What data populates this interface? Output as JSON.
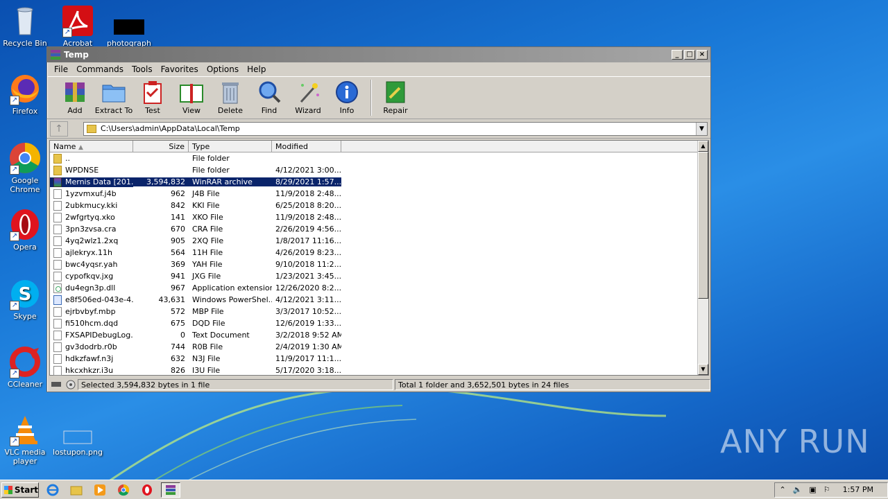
{
  "desktop": {
    "icons": [
      {
        "label": "Recycle Bin"
      },
      {
        "label": "Acrobat"
      },
      {
        "label": "photograph"
      },
      {
        "label": "Firefox"
      },
      {
        "label": "Google Chrome"
      },
      {
        "label": "Opera"
      },
      {
        "label": "Skype"
      },
      {
        "label": "CCleaner"
      },
      {
        "label": "VLC media player"
      },
      {
        "label": "lostupon.png"
      }
    ],
    "watermark": "ANY RUN"
  },
  "window": {
    "title": "Temp",
    "menu": [
      "File",
      "Commands",
      "Tools",
      "Favorites",
      "Options",
      "Help"
    ],
    "toolbar": [
      "Add",
      "Extract To",
      "Test",
      "View",
      "Delete",
      "Find",
      "Wizard",
      "Info",
      "Repair"
    ],
    "address": "C:\\Users\\admin\\AppData\\Local\\Temp",
    "columns": {
      "name": "Name",
      "size": "Size",
      "type": "Type",
      "modified": "Modified"
    },
    "files": [
      {
        "name": "..",
        "size": "",
        "type": "File folder",
        "modified": "",
        "kind": "folder"
      },
      {
        "name": "WPDNSE",
        "size": "",
        "type": "File folder",
        "modified": "4/12/2021 3:00...",
        "kind": "folder"
      },
      {
        "name": "Mernis Data [201...",
        "size": "3,594,832",
        "type": "WinRAR archive",
        "modified": "8/29/2021 1:57...",
        "kind": "rar",
        "selected": true
      },
      {
        "name": "1yzvmxuf.j4b",
        "size": "962",
        "type": "J4B File",
        "modified": "11/9/2018 2:48...",
        "kind": "file"
      },
      {
        "name": "2ubkmucy.kki",
        "size": "842",
        "type": "KKI File",
        "modified": "6/25/2018 8:20...",
        "kind": "file"
      },
      {
        "name": "2wfgrtyq.xko",
        "size": "141",
        "type": "XKO File",
        "modified": "11/9/2018 2:48...",
        "kind": "file"
      },
      {
        "name": "3pn3zvsa.cra",
        "size": "670",
        "type": "CRA File",
        "modified": "2/26/2019 4:56...",
        "kind": "file"
      },
      {
        "name": "4yq2wlz1.2xq",
        "size": "905",
        "type": "2XQ File",
        "modified": "1/8/2017 11:16...",
        "kind": "file"
      },
      {
        "name": "ajlekryx.11h",
        "size": "564",
        "type": "11H File",
        "modified": "4/26/2019 8:23...",
        "kind": "file"
      },
      {
        "name": "bwc4yqsr.yah",
        "size": "369",
        "type": "YAH File",
        "modified": "9/10/2018 11:2...",
        "kind": "file"
      },
      {
        "name": "cypofkqv.jxg",
        "size": "941",
        "type": "JXG File",
        "modified": "1/23/2021 3:45...",
        "kind": "file"
      },
      {
        "name": "du4egn3p.dll",
        "size": "967",
        "type": "Application extension",
        "modified": "12/26/2020 8:2...",
        "kind": "dll"
      },
      {
        "name": "e8f506ed-043e-4...",
        "size": "43,631",
        "type": "Windows PowerShel...",
        "modified": "4/12/2021 3:11...",
        "kind": "ps"
      },
      {
        "name": "ejrbvbyf.mbp",
        "size": "572",
        "type": "MBP File",
        "modified": "3/3/2017 10:52...",
        "kind": "file"
      },
      {
        "name": "fi510hcm.dqd",
        "size": "675",
        "type": "DQD File",
        "modified": "12/6/2019 1:33...",
        "kind": "file"
      },
      {
        "name": "FXSAPIDebugLog...",
        "size": "0",
        "type": "Text Document",
        "modified": "3/2/2018 9:52 AM",
        "kind": "file"
      },
      {
        "name": "gv3dodrb.r0b",
        "size": "744",
        "type": "R0B File",
        "modified": "2/4/2019 1:30 AM",
        "kind": "file"
      },
      {
        "name": "hdkzfawf.n3j",
        "size": "632",
        "type": "N3J File",
        "modified": "11/9/2017 11:1...",
        "kind": "file"
      },
      {
        "name": "hkcxhkzr.i3u",
        "size": "826",
        "type": "I3U File",
        "modified": "5/17/2020 3:18...",
        "kind": "file"
      }
    ],
    "status_left": "Selected 3,594,832 bytes in 1 file",
    "status_right": "Total 1 folder and 3,652,501 bytes in 24 files"
  },
  "taskbar": {
    "start": "Start",
    "clock": "1:57 PM"
  }
}
